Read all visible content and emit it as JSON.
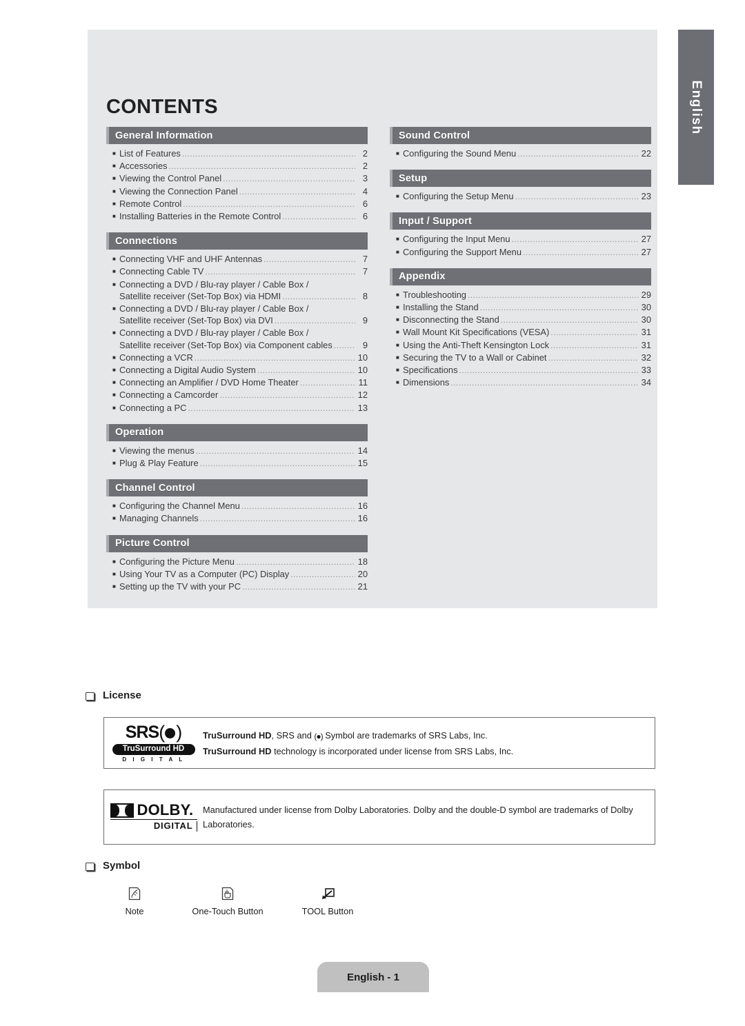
{
  "language_tab": {
    "label": "English"
  },
  "contents": {
    "title": "CONTENTS",
    "left_column": [
      {
        "header": "General Information",
        "items": [
          {
            "label": "List of Features",
            "page": "2"
          },
          {
            "label": "Accessories",
            "page": "2"
          },
          {
            "label": "Viewing the Control Panel",
            "page": "3"
          },
          {
            "label": "Viewing the Connection Panel",
            "page": "4"
          },
          {
            "label": "Remote Control",
            "page": "6"
          },
          {
            "label": "Installing Batteries in the Remote Control",
            "page": "6"
          }
        ]
      },
      {
        "header": "Connections",
        "items": [
          {
            "label": "Connecting VHF and UHF Antennas",
            "page": "7"
          },
          {
            "label": "Connecting Cable TV",
            "page": "7"
          },
          {
            "label": "Connecting a DVD / Blu-ray player / Cable Box /",
            "label2": "Satellite receiver (Set-Top Box) via HDMI",
            "page": "8"
          },
          {
            "label": "Connecting a DVD / Blu-ray player / Cable Box /",
            "label2": "Satellite receiver (Set-Top Box) via DVI",
            "page": "9"
          },
          {
            "label": "Connecting a DVD / Blu-ray player / Cable Box /",
            "label2": "Satellite receiver (Set-Top Box) via Component cables",
            "page": "9"
          },
          {
            "label": "Connecting a VCR",
            "page": "10"
          },
          {
            "label": "Connecting a Digital Audio System",
            "page": "10"
          },
          {
            "label": "Connecting an Amplifier / DVD Home Theater",
            "page": "11"
          },
          {
            "label": "Connecting a Camcorder",
            "page": "12"
          },
          {
            "label": "Connecting a PC",
            "page": "13"
          }
        ]
      },
      {
        "header": "Operation",
        "items": [
          {
            "label": "Viewing the menus",
            "page": "14"
          },
          {
            "label": "Plug & Play Feature",
            "page": "15"
          }
        ]
      },
      {
        "header": "Channel Control",
        "items": [
          {
            "label": "Configuring the Channel Menu",
            "page": "16"
          },
          {
            "label": "Managing Channels",
            "page": "16"
          }
        ]
      },
      {
        "header": "Picture Control",
        "items": [
          {
            "label": "Configuring the Picture Menu",
            "page": "18"
          },
          {
            "label": "Using Your TV as a Computer (PC) Display",
            "page": "20"
          },
          {
            "label": "Setting up the TV with your PC",
            "page": "21"
          }
        ]
      }
    ],
    "right_column": [
      {
        "header": "Sound Control",
        "items": [
          {
            "label": "Configuring the Sound Menu",
            "page": "22"
          }
        ]
      },
      {
        "header": "Setup",
        "items": [
          {
            "label": "Configuring the Setup Menu",
            "page": "23"
          }
        ]
      },
      {
        "header": "Input / Support",
        "items": [
          {
            "label": "Configuring the Input Menu",
            "page": "27"
          },
          {
            "label": "Configuring the Support Menu",
            "page": "27"
          }
        ]
      },
      {
        "header": "Appendix",
        "items": [
          {
            "label": "Troubleshooting",
            "page": "29"
          },
          {
            "label": "Installing the Stand",
            "page": "30"
          },
          {
            "label": "Disconnecting the Stand",
            "page": "30"
          },
          {
            "label": "Wall Mount Kit Specifications (VESA)",
            "page": "31"
          },
          {
            "label": "Using the Anti-Theft Kensington Lock",
            "page": "31"
          },
          {
            "label": "Securing the TV to a Wall or Cabinet",
            "page": "32"
          },
          {
            "label": "Specifications",
            "page": "33"
          },
          {
            "label": "Dimensions",
            "page": "34"
          }
        ]
      }
    ]
  },
  "license": {
    "heading": "License",
    "srs": {
      "logo_main": "SRS",
      "logo_badge": "TruSurround HD",
      "logo_sub": "D I G I T A L",
      "line1_a": "TruSurround HD",
      "line1_b": ", SRS and ",
      "line1_c": " Symbol are trademarks of SRS Labs, Inc.",
      "line2_a": "TruSurround HD",
      "line2_b": " technology is incorporated under license from SRS Labs, Inc."
    },
    "dolby": {
      "logo_word": "DOLBY.",
      "logo_sub": "DIGITAL",
      "text": "Manufactured under license from Dolby Laboratories. Dolby and the double-D symbol are trademarks of Dolby Laboratories."
    }
  },
  "symbol": {
    "heading": "Symbol",
    "items": [
      {
        "icon": "note-pencil-icon",
        "caption": "Note"
      },
      {
        "icon": "one-touch-hand-icon",
        "caption": "One-Touch Button"
      },
      {
        "icon": "tool-arrow-box-icon",
        "caption": "TOOL Button"
      }
    ]
  },
  "footer": {
    "page_label": "English - 1"
  },
  "colors": {
    "panel_bg": "#e6e7e9",
    "section_bar": "#6e7075",
    "section_bar_edge": "#a8aaae",
    "lang_tab": "#6c6e73",
    "page_tab": "#c0c0c0"
  }
}
